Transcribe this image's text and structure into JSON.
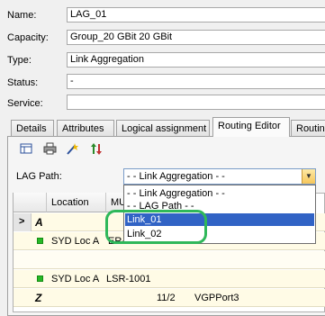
{
  "form": {
    "name_label": "Name:",
    "name_value": "LAG_01",
    "capacity_label": "Capacity:",
    "capacity_value": "Group_20 GBit 20 GBit",
    "type_label": "Type:",
    "type_value": "Link Aggregation",
    "status_label": "Status:",
    "status_value": "-",
    "service_label": "Service:",
    "service_value": ""
  },
  "tabs": [
    "Details",
    "Attributes",
    "Logical assignment",
    "Routing Editor",
    "Routin"
  ],
  "active_tab": "Routing Editor",
  "toolbar_icons": [
    "table-icon",
    "print-icon",
    "route-wand-icon",
    "sort-arrows-icon"
  ],
  "lag_path": {
    "label": "LAG Path:",
    "selected": "- - Link Aggregation - -",
    "options": [
      "- - Link Aggregation - -",
      "- - LAG Path - -",
      "Link_01",
      "Link_02"
    ],
    "highlighted": "Link_01"
  },
  "grid": {
    "columns": [
      "Location",
      "MU"
    ],
    "rows": [
      {
        "marker": ">",
        "letter": "A",
        "location": "",
        "mu": "",
        "port": "",
        "iface": ""
      },
      {
        "marker": "",
        "letter": "",
        "location": "SYD Loc A",
        "mu": "ER-",
        "port": "",
        "iface": ""
      },
      {
        "marker": "",
        "letter": "",
        "location": "",
        "mu": "",
        "port": "",
        "iface": ""
      },
      {
        "marker": "",
        "letter": "",
        "location": "SYD Loc A",
        "mu": "LSR-1001",
        "port": "",
        "iface": ""
      },
      {
        "marker": "",
        "letter": "Z",
        "location": "",
        "mu": "",
        "port": "11/2",
        "iface": "VGPPort3"
      }
    ]
  },
  "colors": {
    "selection": "#3163c5",
    "highlight_ring": "#2fb85a",
    "status_green": "#27b827",
    "row_bg": "#fffbe6"
  }
}
